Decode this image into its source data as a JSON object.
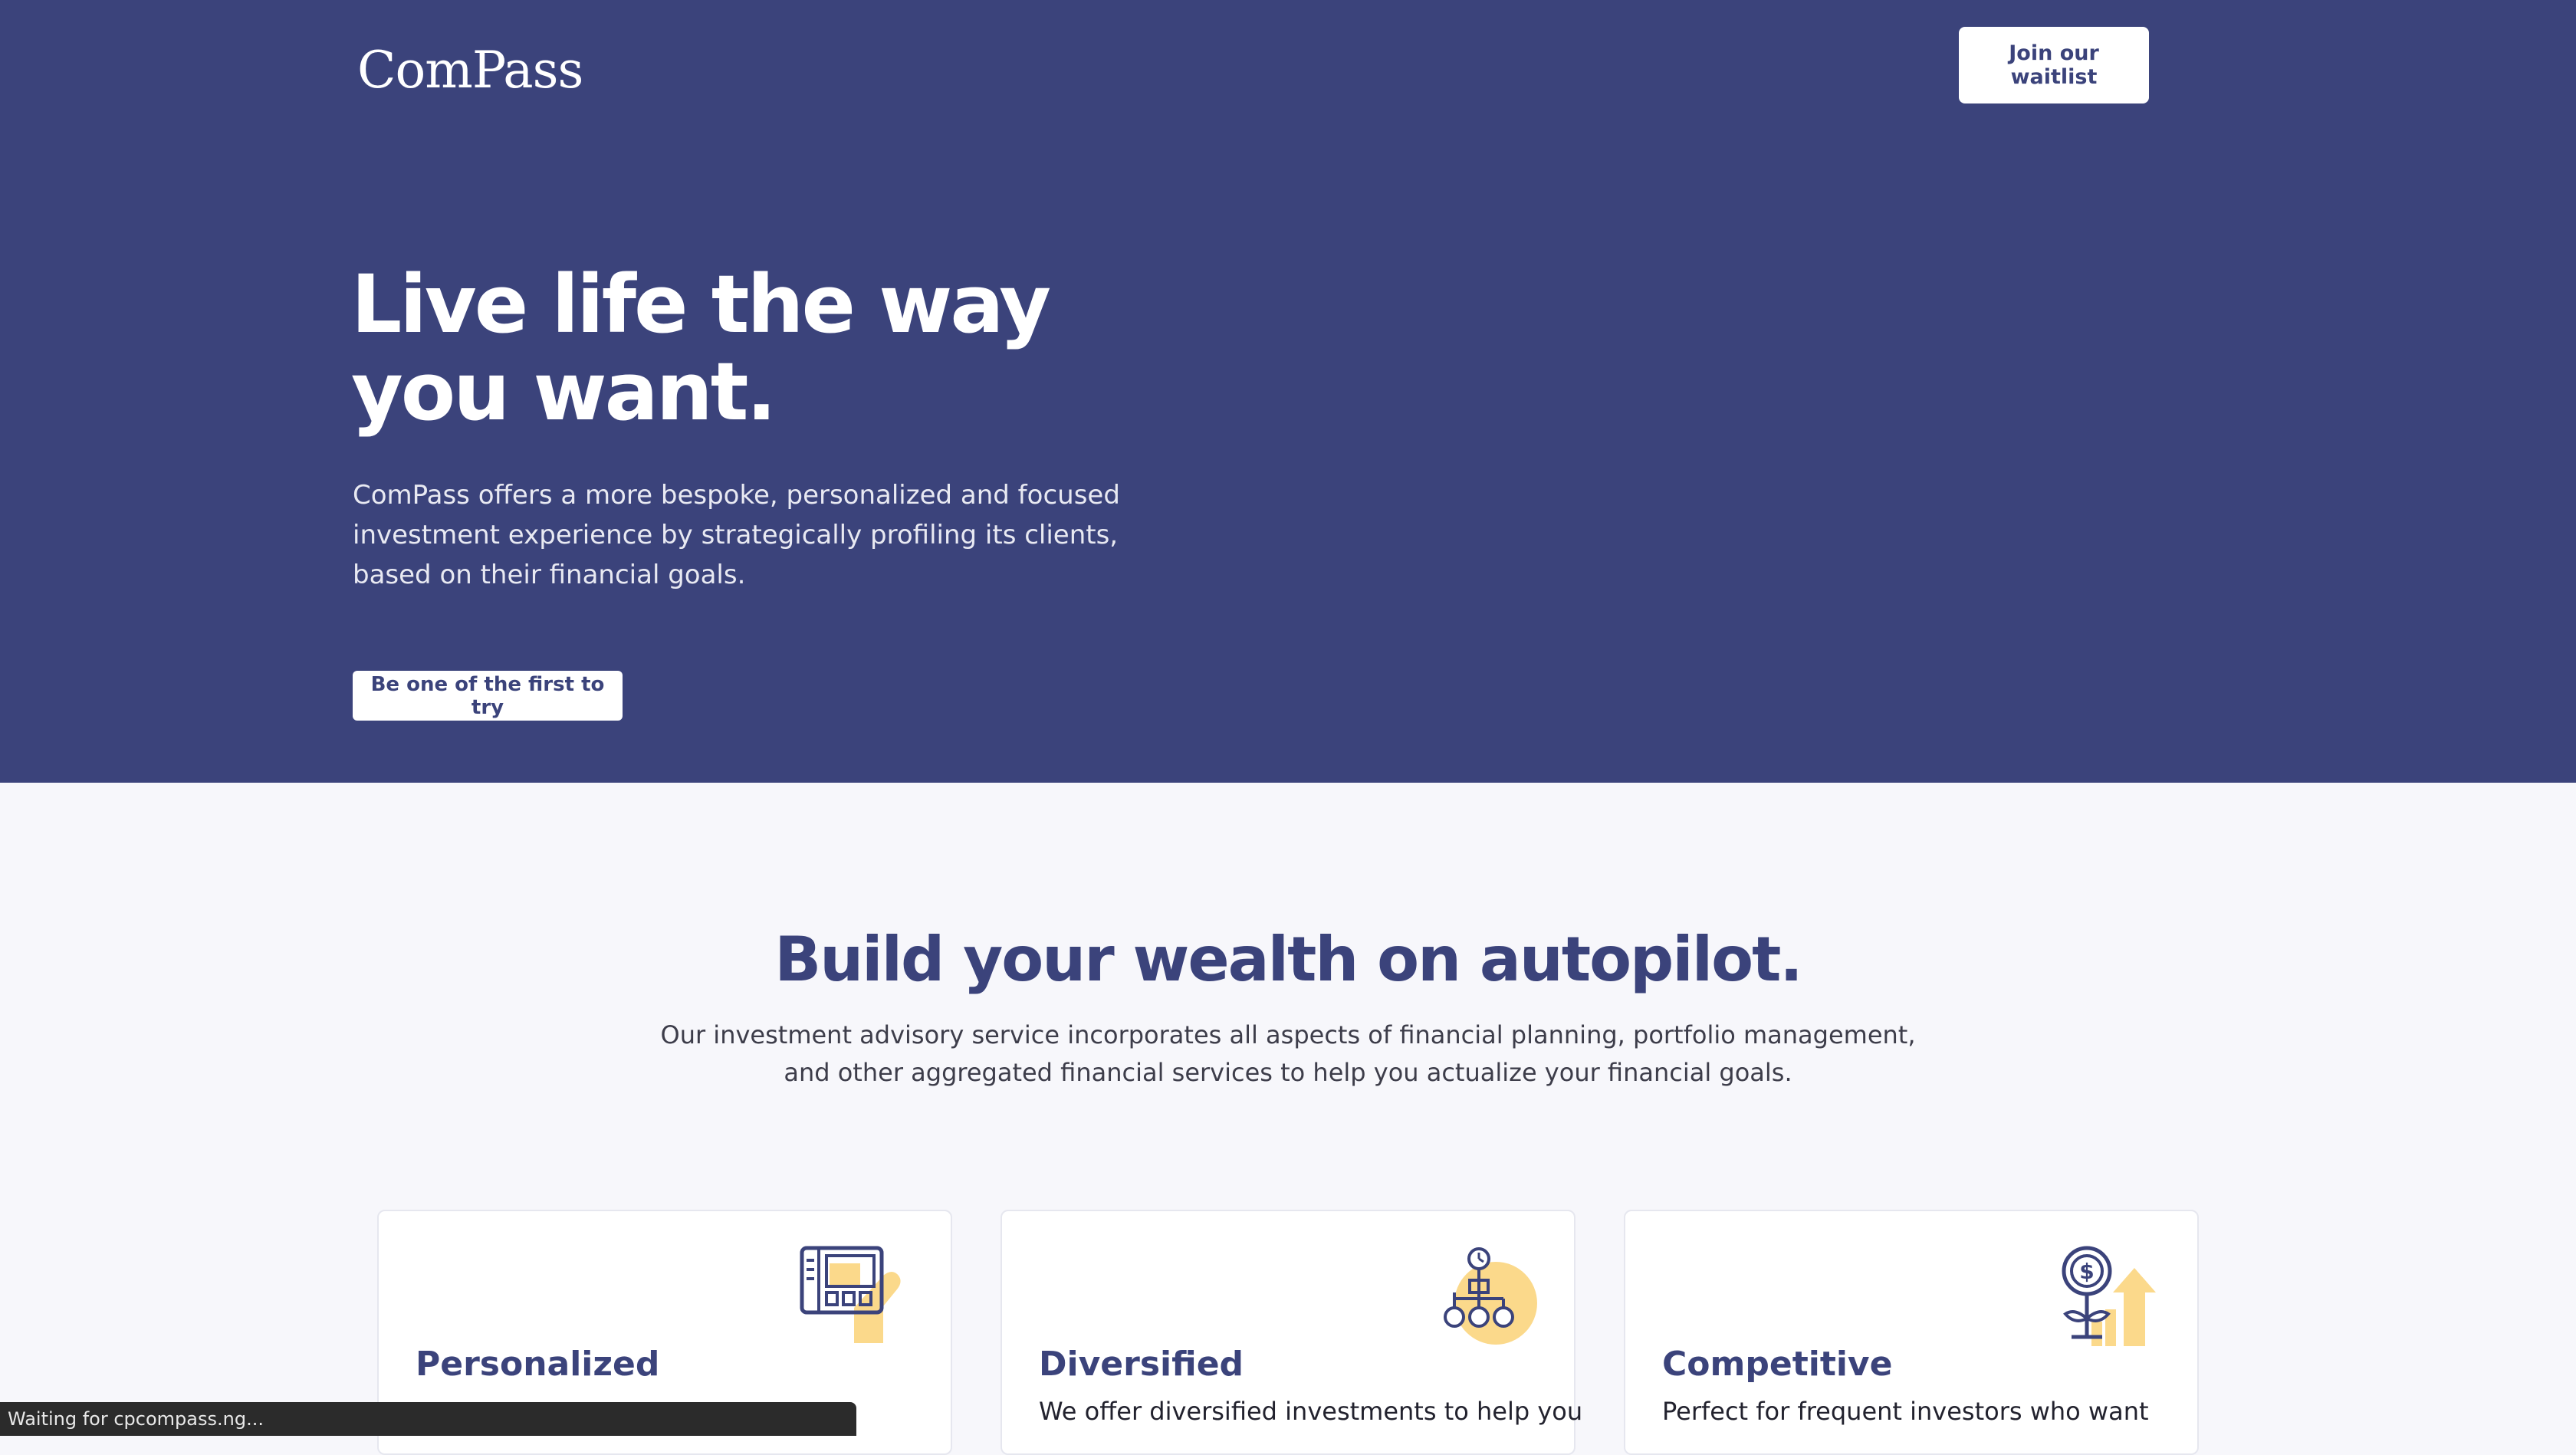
{
  "header": {
    "logo_text": "ComPass",
    "waitlist_button": "Join our waitlist"
  },
  "hero": {
    "title_line1": "Live life the way",
    "title_line2": "you want.",
    "subtitle": "ComPass offers a more bespoke, personalized and focused investment experience by strategically profiling its clients, based on their financial goals.",
    "cta_button": "Be one of the first to try"
  },
  "features": {
    "title": "Build your wealth on autopilot.",
    "subtitle": "Our investment advisory service incorporates all aspects of financial planning, portfolio management, and other aggregated financial services to help you actualize your financial goals.",
    "cards": [
      {
        "title": "Personalized",
        "text": "",
        "icon": "tablet-hand-icon"
      },
      {
        "title": "Diversified",
        "text": "We offer diversified investments to help you",
        "icon": "network-pie-icon"
      },
      {
        "title": "Competitive",
        "text": "Perfect for frequent investors who want",
        "icon": "money-plant-growth-icon"
      }
    ]
  },
  "status_bar": {
    "text": "Waiting for cpcompass.ng..."
  },
  "colors": {
    "brand_navy": "#3b437b",
    "accent_yellow": "#fbd98b",
    "page_bg": "#f7f7fb"
  }
}
